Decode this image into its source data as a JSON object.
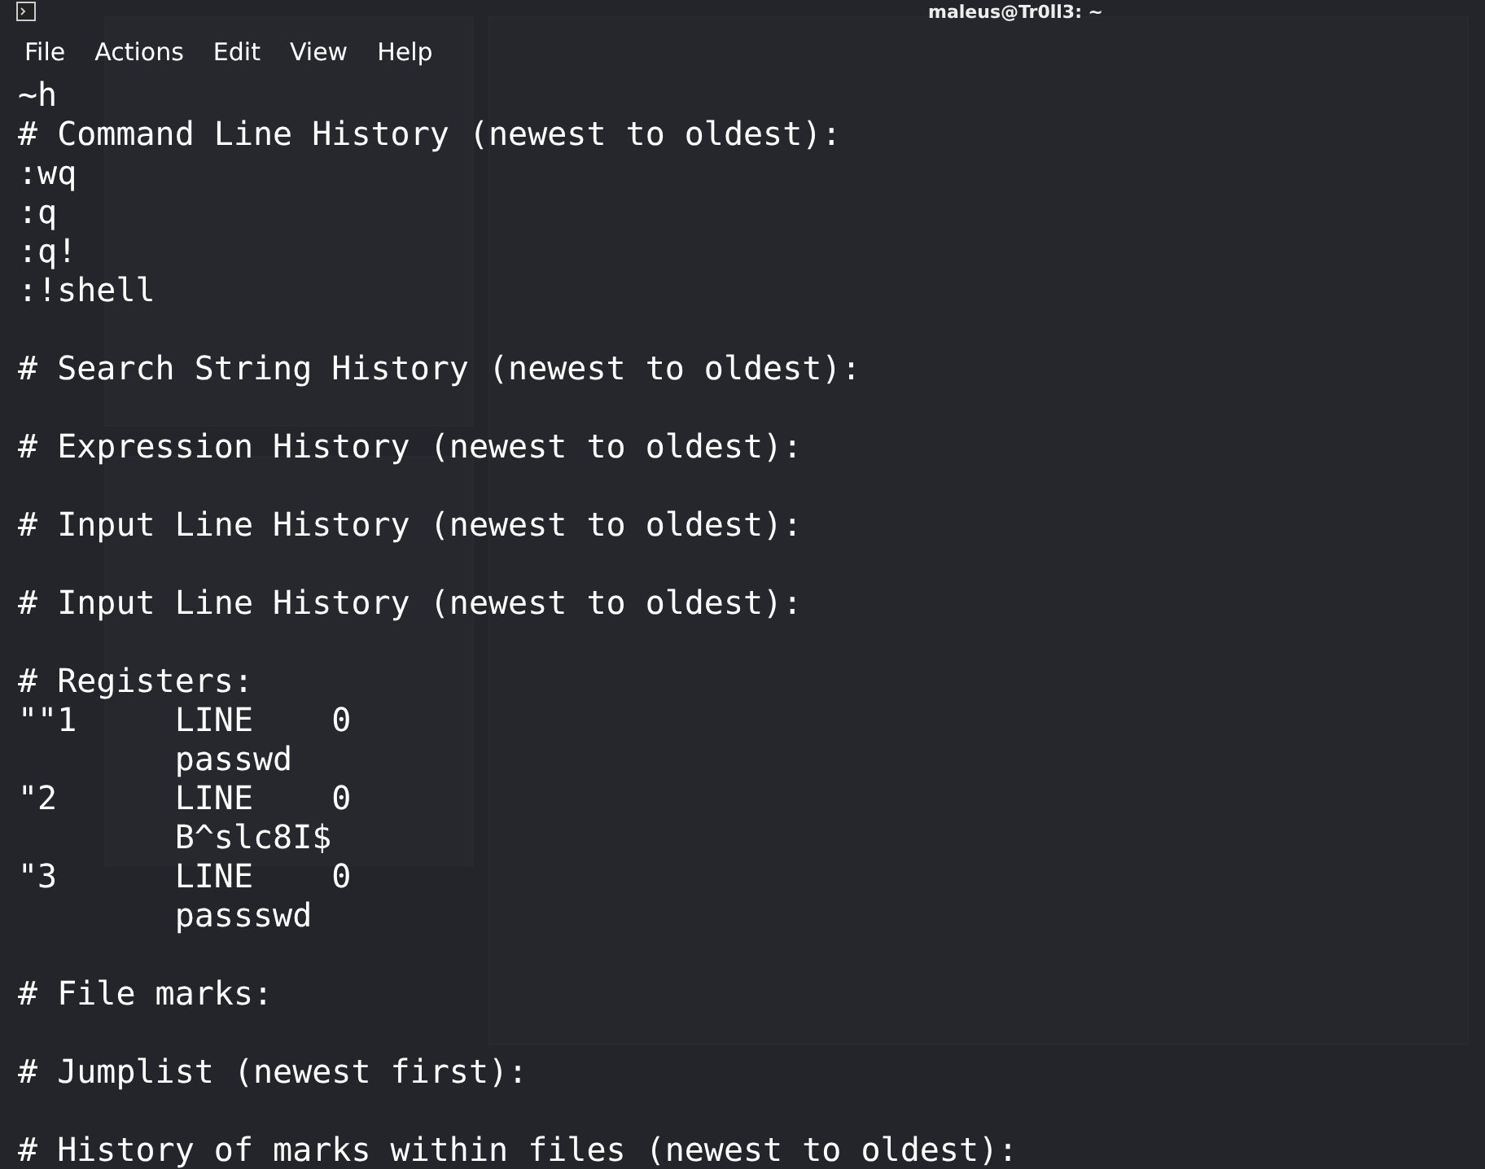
{
  "window": {
    "title": "maleus@Tr0ll3: ~"
  },
  "menu": [
    "File",
    "Actions",
    "Edit",
    "View",
    "Help"
  ],
  "blocks": [
    [
      "~h",
      "# Command Line History (newest to oldest):",
      ":wq",
      ":q",
      ":q!",
      ":!shell"
    ],
    [
      "# Search String History (newest to oldest):"
    ],
    [
      "# Expression History (newest to oldest):"
    ],
    [
      "# Input Line History (newest to oldest):"
    ],
    [
      "# Input Line History (newest to oldest):"
    ],
    [
      "# Registers:",
      "\"\"1     LINE    0",
      "        passwd",
      "\"2      LINE    0",
      "        B^slc8I$",
      "\"3      LINE    0",
      "        passswd"
    ],
    [
      "# File marks:"
    ],
    [
      "# Jumplist (newest first):"
    ],
    [
      "# History of marks within files (newest to oldest):"
    ]
  ]
}
